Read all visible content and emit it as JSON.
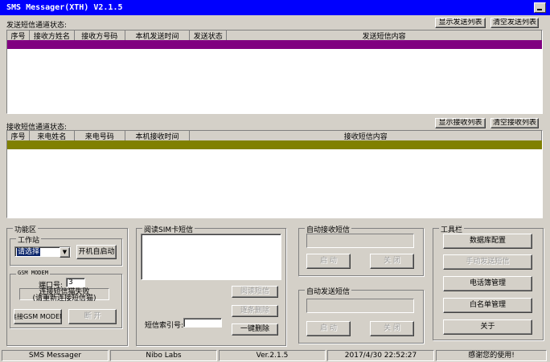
{
  "window": {
    "title": "SMS Messager(XTH) V2.1.5"
  },
  "colors": {
    "titlebar": "#0000fe",
    "send_row": "#800080",
    "recv_row": "#808000",
    "face": "#d4d0c8"
  },
  "send": {
    "status_label": "发送短信通道状态:",
    "btn_show": "显示发送列表",
    "btn_clear": "清空发送列表",
    "columns": [
      "序号",
      "接收方姓名",
      "接收方号码",
      "本机发送时间",
      "发送状态",
      "发送短信内容"
    ]
  },
  "recv": {
    "status_label": "接收短信通道状态:",
    "btn_show": "显示接收列表",
    "btn_clear": "清空接收列表",
    "columns": [
      "序号",
      "来电姓名",
      "来电号码",
      "本机接收时间",
      "接收短信内容"
    ]
  },
  "func": {
    "title": "功能区",
    "workstation": {
      "title": "工作站",
      "select_value": "请选择",
      "btn_auto": "开机自启动"
    },
    "gsm": {
      "title": "GSM MODEM",
      "port_label": "端口号:",
      "port_value": "3",
      "status_line1": "连接短信猫失败",
      "status_line2": "(请重新连接短信猫)",
      "btn_connect": "连接GSM MODEM",
      "btn_disconnect": "断  开"
    }
  },
  "sim": {
    "title": "阅读SIM卡短信",
    "btn_read": "阅读短信",
    "btn_delete_one": "逐条删除",
    "index_label": "短信索引号:",
    "index_value": "",
    "btn_delete_all": "一键删除"
  },
  "auto_recv": {
    "title": "自动接收短信",
    "btn_start": "启  动",
    "btn_stop": "关  闭"
  },
  "auto_send": {
    "title": "自动发送短信",
    "btn_start": "启  动",
    "btn_stop": "关  闭"
  },
  "tools": {
    "title": "工具栏",
    "btn_db": "数据库配置",
    "btn_manual": "手动发送短信",
    "btn_phonebook": "电话簿管理",
    "btn_whitelist": "白名单管理",
    "btn_about": "关于"
  },
  "statusbar": {
    "app": "SMS Messager",
    "company": "Nibo Labs",
    "version": "Ver.2.1.5",
    "datetime": "2017/4/30 22:52:27",
    "thanks": "感谢您的使用!"
  }
}
